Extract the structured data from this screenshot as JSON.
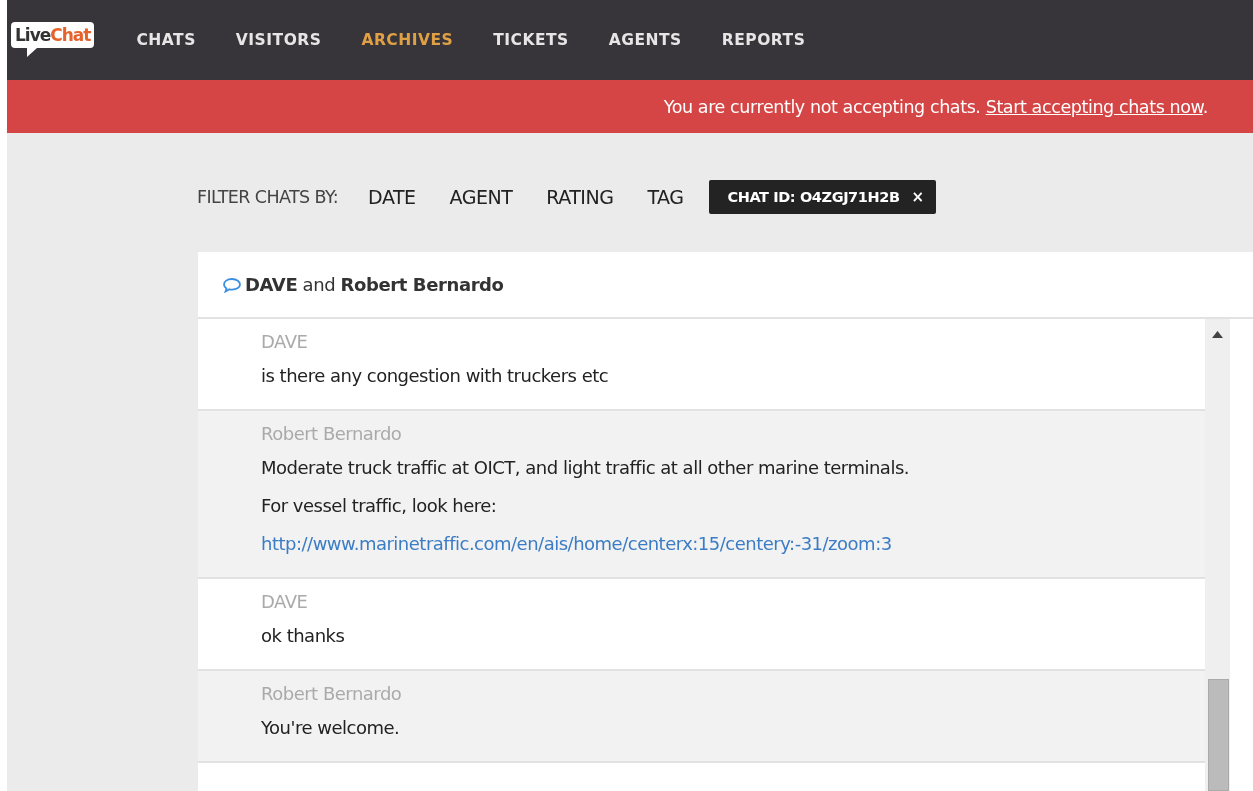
{
  "logo": {
    "part_1": "Live",
    "part_2": "Chat"
  },
  "nav": [
    {
      "label": "CHATS",
      "selected": false
    },
    {
      "label": "VISITORS",
      "selected": false
    },
    {
      "label": "ARCHIVES",
      "selected": true
    },
    {
      "label": "TICKETS",
      "selected": false
    },
    {
      "label": "AGENTS",
      "selected": false
    },
    {
      "label": "REPORTS",
      "selected": false
    }
  ],
  "banner": {
    "text": "You are currently not accepting chats.",
    "link": "Start accepting chats now",
    "after": "."
  },
  "filter": {
    "label": "FILTER CHATS BY:",
    "options": [
      "DATE",
      "AGENT",
      "RATING",
      "TAG"
    ],
    "chip": {
      "label": "CHAT ID: O4ZGJ71H2B",
      "close": "×"
    }
  },
  "chat": {
    "title": "**DAVE** and **Robert Bernardo**",
    "messages": [
      {
        "author": "DAVE",
        "shaded": false,
        "lines": [
          {
            "kind": "text",
            "text": "is there any congestion with truckers etc"
          }
        ]
      },
      {
        "author": "Robert Bernardo",
        "shaded": true,
        "lines": [
          {
            "kind": "text",
            "text": "Moderate truck traffic at OICT, and light traffic at all other marine terminals."
          },
          {
            "kind": "text",
            "text": "For vessel traffic, look here:"
          },
          {
            "kind": "link",
            "text": "http://www.marinetraffic.com/en/ais/home/centerx:15/centery:-31/zoom:3"
          }
        ]
      },
      {
        "author": "DAVE",
        "shaded": false,
        "lines": [
          {
            "kind": "text",
            "text": "ok thanks"
          }
        ]
      },
      {
        "author": "Robert Bernardo",
        "shaded": true,
        "lines": [
          {
            "kind": "text",
            "text": "You're welcome."
          }
        ]
      }
    ]
  }
}
